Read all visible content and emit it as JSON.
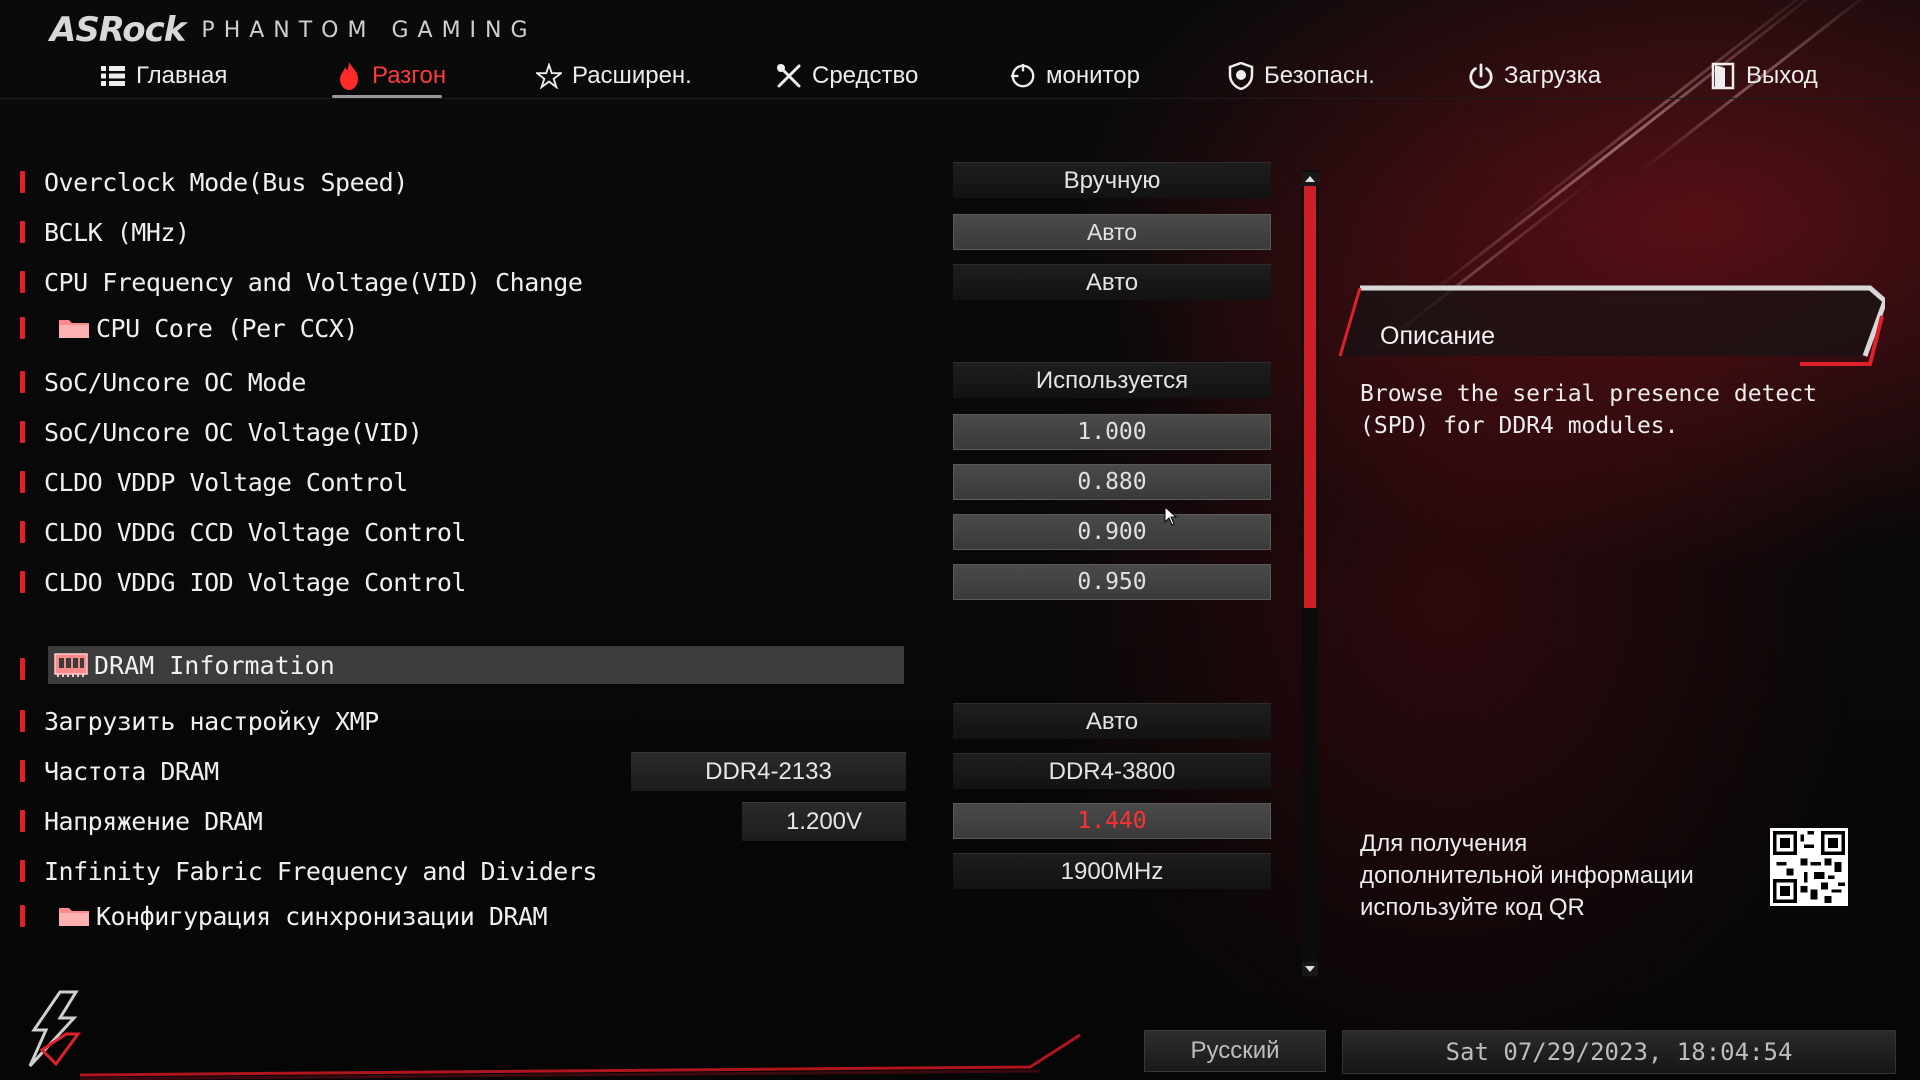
{
  "brand": {
    "logo": "ASRock",
    "subtitle": "PHANTOM GAMING"
  },
  "nav": {
    "tabs": [
      {
        "label": "Главная",
        "icon": "list-icon",
        "active": false
      },
      {
        "label": "Разгон",
        "icon": "flame-icon",
        "active": true
      },
      {
        "label": "Расширен.",
        "icon": "star-icon",
        "active": false
      },
      {
        "label": "Средство",
        "icon": "tools-icon",
        "active": false
      },
      {
        "label": "монитор",
        "icon": "crosshair-icon",
        "active": false
      },
      {
        "label": "Безопасн.",
        "icon": "shield-icon",
        "active": false
      },
      {
        "label": "Загрузка",
        "icon": "power-icon",
        "active": false
      },
      {
        "label": "Выход",
        "icon": "exit-door-icon",
        "active": false
      }
    ]
  },
  "settings": [
    {
      "label": "Overclock Mode(Bus Speed)",
      "value": "Вручную"
    },
    {
      "label": "BCLK (MHz)",
      "value": "Авто"
    },
    {
      "label": "CPU Frequency and Voltage(VID) Change",
      "value": "Авто"
    },
    {
      "label": "CPU Core (Per CCX)"
    },
    {
      "label": "SoC/Uncore OC Mode",
      "value": "Используется"
    },
    {
      "label": "SoC/Uncore OC Voltage(VID)",
      "value": "1.000"
    },
    {
      "label": "CLDO VDDP Voltage Control",
      "value": "0.880"
    },
    {
      "label": "CLDO VDDG CCD Voltage Control",
      "value": "0.900"
    },
    {
      "label": "CLDO VDDG IOD Voltage Control",
      "value": "0.950"
    }
  ],
  "dram_section": {
    "label": "DRAM Information"
  },
  "dram_settings": [
    {
      "label": "Загрузить настройку XMP",
      "value": "Авто"
    },
    {
      "label": "Частота DRAM",
      "current": "DDR4-2133",
      "value": "DDR4-3800"
    },
    {
      "label": "Напряжение DRAM",
      "current": "1.200V",
      "value": "1.440"
    },
    {
      "label": "Infinity Fabric Frequency and Dividers",
      "value": "1900MHz"
    },
    {
      "label": "Конфигурация синхронизации DRAM"
    }
  ],
  "colors": {
    "accent": "#e0202a",
    "warn_value": "#ff3030"
  },
  "description": {
    "title": "Описание",
    "text": "Browse the serial presence detect\n(SPD) for DDR4 modules."
  },
  "qr_info": {
    "text": "Для получения\nдополнительной информации\nиспользуйте код QR"
  },
  "footer": {
    "language": "Русский",
    "datetime": "Sat 07/29/2023, 18:04:54"
  }
}
